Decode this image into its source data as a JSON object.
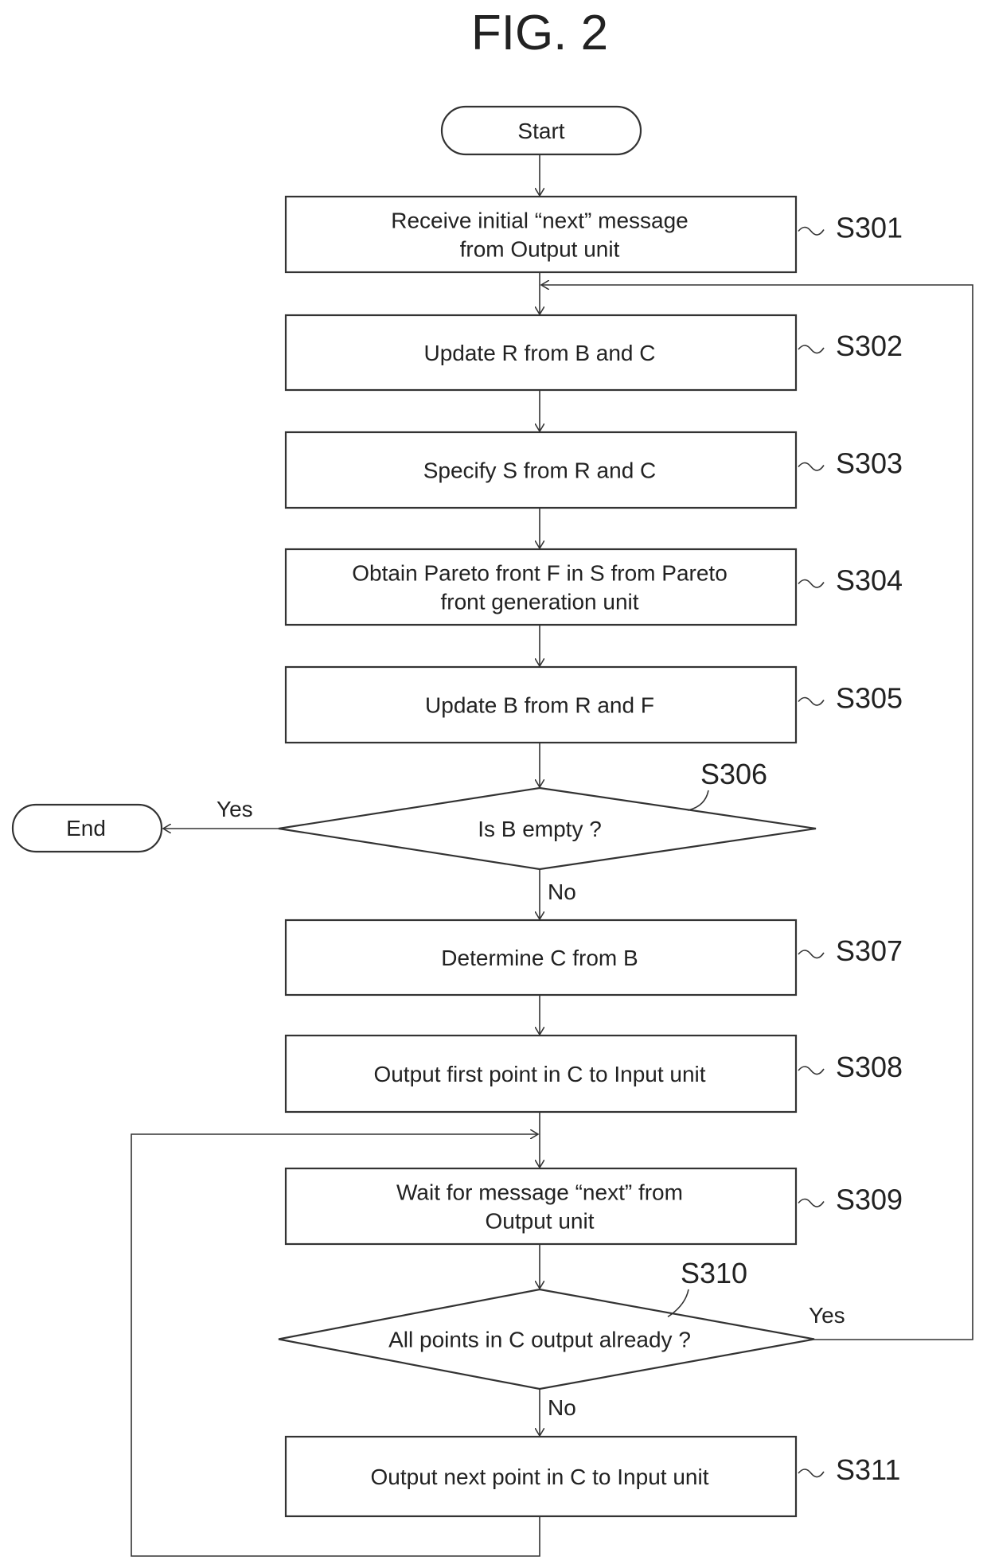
{
  "figure": {
    "title": "FIG. 2",
    "start_label": "Start",
    "end_label": "End",
    "steps": [
      {
        "id": "S301",
        "type": "process",
        "lines": [
          "Receive initial “next” message",
          "from Output unit"
        ]
      },
      {
        "id": "S302",
        "type": "process",
        "lines": [
          "Update R from B and C"
        ]
      },
      {
        "id": "S303",
        "type": "process",
        "lines": [
          "Specify S from R and C"
        ]
      },
      {
        "id": "S304",
        "type": "process",
        "lines": [
          "Obtain Pareto front F in S from Pareto",
          "front generation unit"
        ]
      },
      {
        "id": "S305",
        "type": "process",
        "lines": [
          "Update B from R and F"
        ]
      },
      {
        "id": "S306",
        "type": "decision",
        "lines": [
          "Is B empty ?"
        ],
        "yes": "Yes",
        "no": "No"
      },
      {
        "id": "S307",
        "type": "process",
        "lines": [
          "Determine C from B"
        ]
      },
      {
        "id": "S308",
        "type": "process",
        "lines": [
          "Output first point in C to Input unit"
        ]
      },
      {
        "id": "S309",
        "type": "process",
        "lines": [
          "Wait for message “next” from",
          "Output unit"
        ]
      },
      {
        "id": "S310",
        "type": "decision",
        "lines": [
          "All points in C output already ?"
        ],
        "yes": "Yes",
        "no": "No"
      },
      {
        "id": "S311",
        "type": "process",
        "lines": [
          "Output next point in C to Input unit"
        ]
      }
    ]
  }
}
